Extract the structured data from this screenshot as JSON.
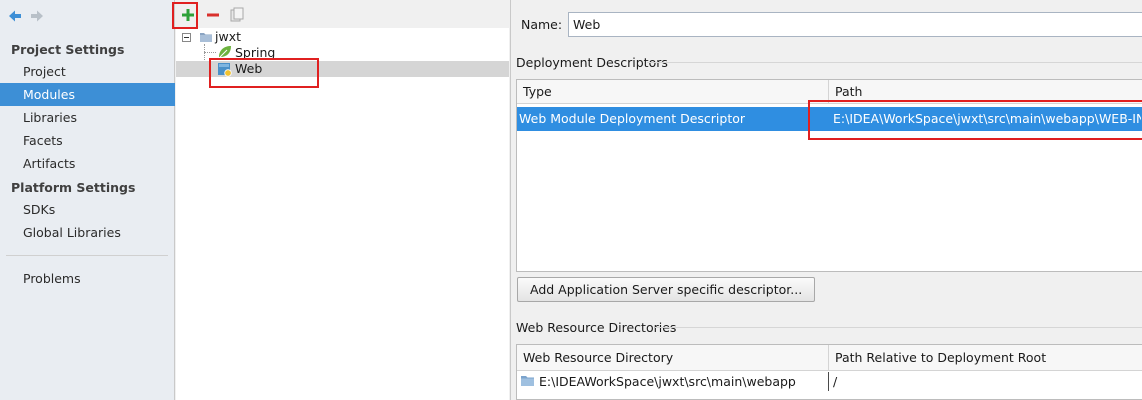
{
  "sidebar": {
    "project_settings_title": "Project Settings",
    "project_items": [
      "Project",
      "Modules",
      "Libraries",
      "Facets",
      "Artifacts"
    ],
    "platform_settings_title": "Platform Settings",
    "platform_items": [
      "SDKs",
      "Global Libraries"
    ],
    "problems_label": "Problems",
    "selected_item": "Modules"
  },
  "tree": {
    "toolbar": {
      "add_icon": "plus-icon",
      "remove_icon": "minus-icon",
      "copy_icon": "copy-icon"
    },
    "root_label": "jwxt",
    "children": [
      {
        "label": "Spring",
        "icon": "spring-leaf-icon"
      },
      {
        "label": "Web",
        "icon": "web-facet-icon"
      }
    ],
    "selected": "Web"
  },
  "details": {
    "name_label": "Name:",
    "name_value": "Web",
    "deployment": {
      "title": "Deployment Descriptors",
      "columns": [
        "Type",
        "Path"
      ],
      "rows": [
        {
          "type": "Web Module Deployment Descriptor",
          "path": "E:\\IDEA\\WorkSpace\\jwxt\\src\\main\\webapp\\WEB-INF\\"
        }
      ],
      "add_button": "Add Application Server specific descriptor..."
    },
    "resources": {
      "title": "Web Resource Directories",
      "columns": [
        "Web Resource Directory",
        "Path Relative to Deployment Root"
      ],
      "rows": [
        {
          "directory": "E:\\IDEAWorkSpace\\jwxt\\src\\main\\webapp",
          "relative": "/"
        }
      ]
    }
  },
  "colors": {
    "selection_blue": "#3d8fd6",
    "highlight_red": "#e02020",
    "add_green": "#2fa13a",
    "remove_red": "#d9302c"
  }
}
